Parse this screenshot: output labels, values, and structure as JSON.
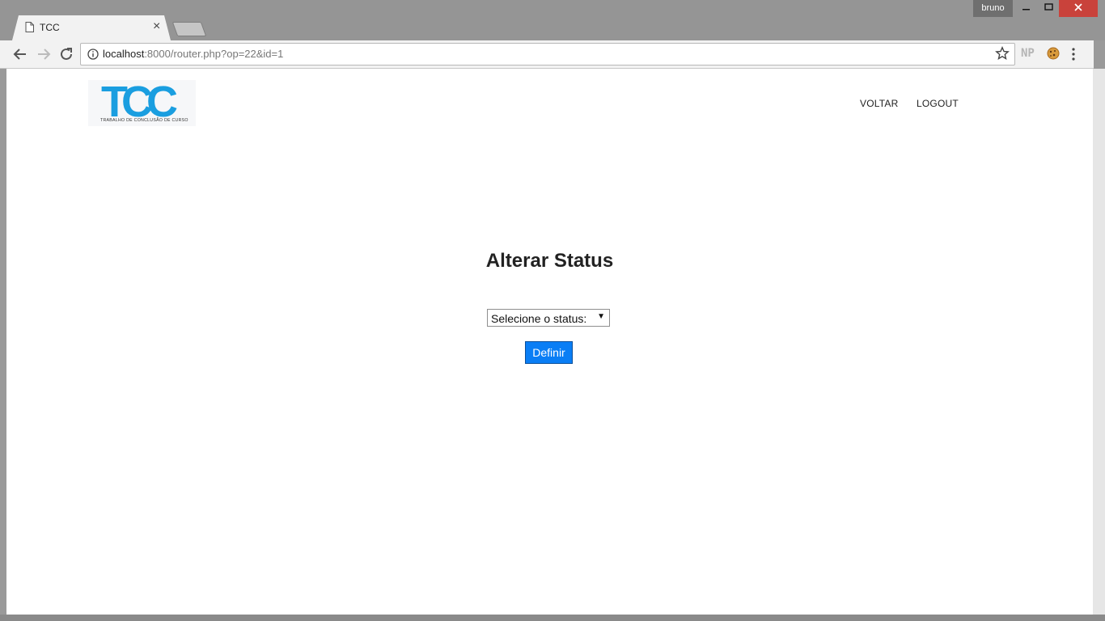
{
  "browser": {
    "profile_name": "bruno",
    "tab_title": "TCC",
    "url_host": "localhost",
    "url_rest": ":8000/router.php?op=22&id=1",
    "extension_np_label": "NP"
  },
  "site": {
    "logo_text": "TCC",
    "logo_subtitle": "TRABALHO DE CONCLUSÃO DE CURSO",
    "nav": {
      "voltar": "VOLTAR",
      "logout": "LOGOUT"
    }
  },
  "main": {
    "title": "Alterar Status",
    "status_select_value": "Selecione o status:",
    "submit_label": "Definir"
  },
  "colors": {
    "accent": "#0a7ef5",
    "logo_blue": "#1a9ee0",
    "close_button": "#c9423b"
  }
}
